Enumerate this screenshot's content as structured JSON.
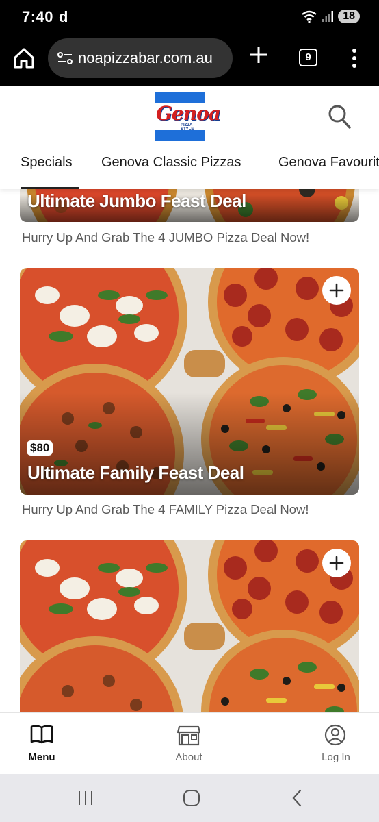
{
  "status_bar": {
    "time": "7:40",
    "extra_icon": "d",
    "icons": [
      "wifi-icon",
      "signal-icon"
    ],
    "battery": "18"
  },
  "browser": {
    "url": "noapizzabar.com.au",
    "tab_count": "9",
    "icons": [
      "home-icon",
      "site-settings-icon",
      "plus-icon",
      "tab-switcher-icon",
      "more-vert-icon"
    ]
  },
  "header": {
    "logo_text": "Genoa",
    "logo_subtext": "PIZZA STYLE",
    "search_icon": "search-icon",
    "tabs": [
      {
        "label": "Specials",
        "active": true
      },
      {
        "label": "Genova Classic Pizzas",
        "active": false
      },
      {
        "label": "Genova Favourites",
        "active": false
      }
    ]
  },
  "deals": [
    {
      "title": "Ultimate Jumbo Feast Deal",
      "price": "",
      "description": "Hurry Up And Grab The 4 JUMBO Pizza Deal Now!"
    },
    {
      "title": "Ultimate Family Feast Deal",
      "price": "$80",
      "description": "Hurry Up And Grab The 4 FAMILY Pizza Deal Now!"
    },
    {
      "title": "",
      "price": "",
      "description": ""
    }
  ],
  "bottom_nav": [
    {
      "label": "Menu",
      "icon": "book-icon",
      "active": true
    },
    {
      "label": "About",
      "icon": "store-icon",
      "active": false
    },
    {
      "label": "Log In",
      "icon": "account-icon",
      "active": false
    }
  ],
  "android_nav": [
    "recents-icon",
    "home-circle-icon",
    "back-icon"
  ],
  "colors": {
    "brand_blue": "#1e6fd9",
    "brand_red": "#d42020",
    "text_muted": "#5a5a5a"
  }
}
